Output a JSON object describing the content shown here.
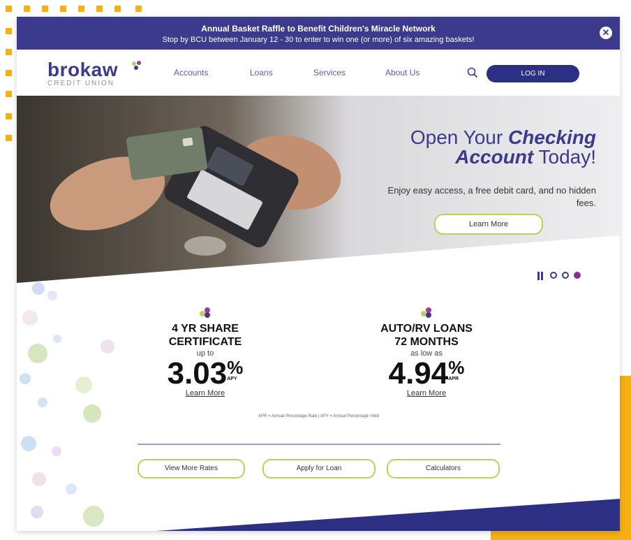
{
  "announcement": {
    "title": "Annual Basket Raffle to Benefit Children's Miracle Network",
    "text": "Stop by BCU between January 12 - 30 to enter to win one (or more) of six amazing baskets!",
    "close_icon": "close-icon"
  },
  "header": {
    "logo_word": "brokaw",
    "logo_sub": "CREDIT UNION",
    "nav": [
      "Accounts",
      "Loans",
      "Services",
      "About Us"
    ],
    "search_icon": "search-icon",
    "login_label": "LOG IN"
  },
  "hero": {
    "title_line1_a": "Open Your ",
    "title_line1_b": "Checking",
    "title_line2_a": "Account",
    "title_line2_b": " Today!",
    "subtitle": "Enjoy easy access, a free debit card, and no hidden fees.",
    "button": "Learn More",
    "slider": {
      "pause_icon": "pause-icon",
      "dots": 3,
      "active_dot": 3
    }
  },
  "rates": [
    {
      "title_line1": "4 YR SHARE",
      "title_line2": "CERTIFICATE",
      "prefix": "up to",
      "value": "3.03",
      "percent": "%",
      "unit": "APY",
      "link": "Learn More"
    },
    {
      "title_line1": "AUTO/RV LOANS",
      "title_line2": "72 MONTHS",
      "prefix": "as low as",
      "value": "4.94",
      "percent": "%",
      "unit": "APR",
      "link": "Learn More"
    }
  ],
  "footnote": "APR = Annual Percentage Rate | APY = Annual Percentage Yield",
  "actions": [
    "View More Rates",
    "Apply for Loan",
    "Calculators"
  ],
  "colors": {
    "brand": "#3b3a8c",
    "accent": "#b9d25a",
    "highlight": "#f5b014"
  }
}
